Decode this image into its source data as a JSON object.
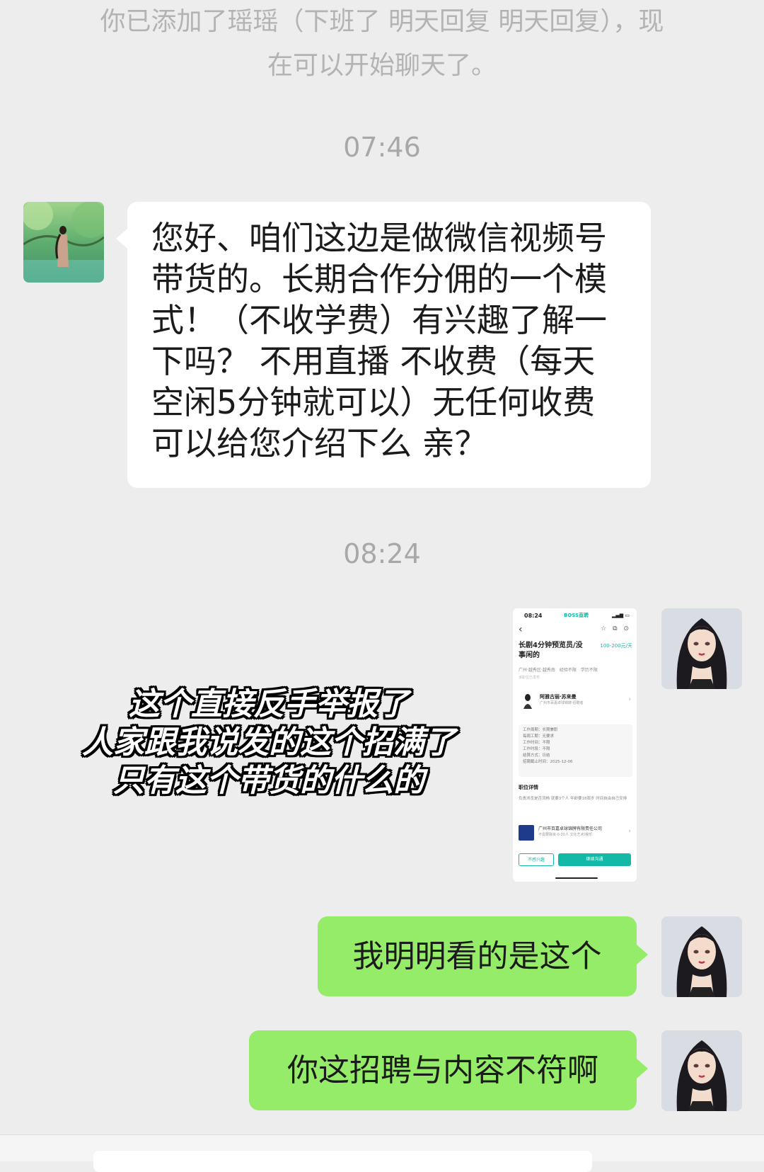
{
  "system_notice": {
    "line1": "你已添加了瑶瑶（下班了 明天回复 明天回复），现",
    "line2": "在可以开始聊天了。"
  },
  "timestamps": [
    "07:46",
    "08:24"
  ],
  "messages": {
    "incoming": {
      "line1": "您好、咱们这边是做微信视频号",
      "line2": "带货的。长期合作分佣的一个模",
      "line3": "式！（不收学费）有兴趣了解一",
      "line4": "下吗？ 不用直播 不收费（每天",
      "line5": "空闲5分钟就可以）无任何收费",
      "line6": "可以给您介绍下么 亲？"
    },
    "outgoing": [
      "我明明看的是这个",
      "你这招聘与内容不符啊"
    ]
  },
  "overlay_caption": [
    "这个直接反手举报了",
    "人家跟我说发的这个招满了",
    "只有这个带货的什么的"
  ],
  "job_screenshot": {
    "status_time": "08:24",
    "brand": "BOSS直聘",
    "title": "长剧4分钟预览员/没事闲的",
    "salary": "100-200元/天",
    "tags": "广州·越秀区·越秀南　经验不限　学历不限",
    "sub_note": "该职位已发布",
    "recruiter_name": "阿雅古丽·苏来曼",
    "recruiter_company": "广州市百嘉卓球锦牌·招聘者",
    "rows": [
      "工作周期：长期兼职",
      "每周工期：无要求",
      "工作时间：不限",
      "工作时段：不限",
      "结算方式：日结",
      "招聘截止时间：2025-12-06"
    ],
    "section_title": "职位详情",
    "description": "负责浏览是否流畅 就要3个人 年龄要18周岁 时间自由自己安排",
    "company_name": "广州市百嘉卓球锦牌有限责任公司",
    "company_meta": "不需要融资·0-20人·文化艺术/娱乐",
    "btn_secondary": "不感兴趣",
    "btn_primary": "继续沟通"
  },
  "colors": {
    "background": "#ededed",
    "incoming_bubble": "#ffffff",
    "outgoing_bubble": "#95ec69",
    "accent": "#14b8a6"
  }
}
